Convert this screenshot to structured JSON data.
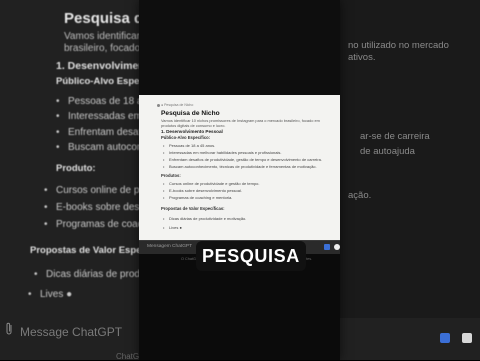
{
  "background_chat": {
    "title": "Pesquisa de Ni",
    "intro_line1": "Vamos identificar 10",
    "intro_line2": "brasileiro, focado em",
    "section1": "1. Desenvolvimen",
    "subhead": "Público-Alvo Especifi",
    "items": [
      "Pessoas de 18 a 4",
      "Interessadas em",
      "Enfrentam desafio",
      "Buscam autoconhe"
    ],
    "produtos_label": "Produto:",
    "produtos": [
      "Cursos online de pro",
      "E-books sobre desen",
      "Programas de coach"
    ],
    "propostas_label": "Propostas de Valor Especi",
    "propostas": [
      "Dicas diárias de prod",
      "Lives ●"
    ],
    "input_placeholder": "Message ChatGPT",
    "right_snippets": [
      "no utilizado no mercado",
      "ativos.",
      "ar-se de carreira",
      "de autoajuda",
      "ação."
    ],
    "footer_note": "ChatGPT"
  },
  "panel": {
    "top_meta": "● Pesquisa de Nicho",
    "title": "Pesquisa de Nicho",
    "intro": "Vamos identificar 10 nichos promissores de Instagram para o mercado brasileiro, focado em produtos digitais de consumo e lucro.",
    "section1": "1. Desenvolvimento Pessoal",
    "subhead": "Público-Alvo Específico:",
    "items": [
      "Pessoas de 18 a 45 anos.",
      "Interessadas em melhorar habilidades pessoais e profissionais.",
      "Enfrentam desafios de produtividade, gestão de tempo e desenvolvimento de carreira.",
      "Buscam autoconhecimento, técnicas de produtividade e ferramentas de motivação."
    ],
    "produtos_label": "Produtos:",
    "produtos": [
      "Cursos online de produtividade e gestão de tempo.",
      "E-books sobre desenvolvimento pessoal.",
      "Programas de coaching e mentoria."
    ],
    "propostas_label": "Propostas de Valor Específicas:",
    "propostas": [
      "Dicas diárias de produtividade e motivação.",
      "Lives ●"
    ],
    "input_placeholder": "Mensagem ChatGPT",
    "footer_note": "O ChatGPT pode cometer erros. Considere verificar informações importantes."
  },
  "caption": "PESQUISA"
}
